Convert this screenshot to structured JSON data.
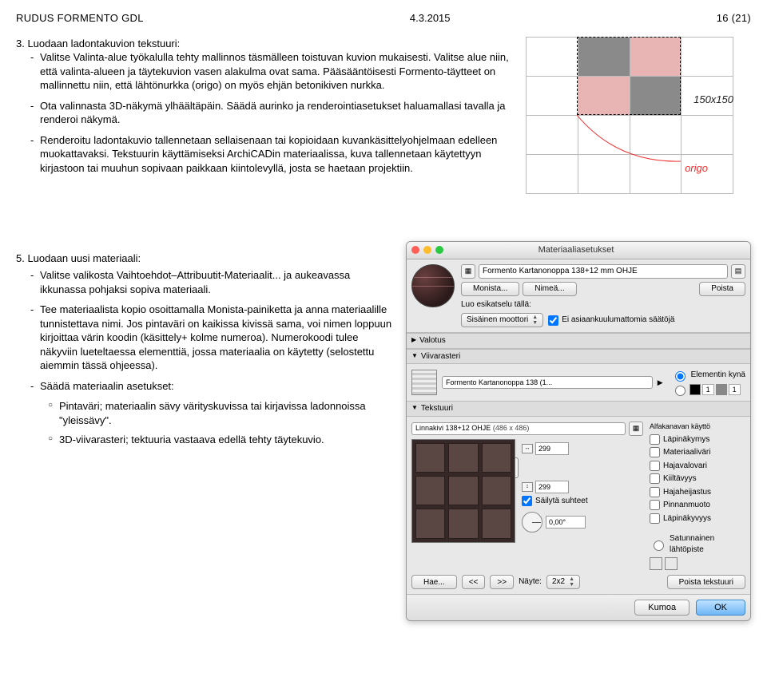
{
  "header": {
    "left": "RUDUS FORMENTO GDL",
    "date": "4.3.2015",
    "page": "16 (21)"
  },
  "sec3": {
    "title": "3. Luodaan ladontakuvion tekstuuri:",
    "b1": "Valitse Valinta-alue työkalulla tehty mallinnos täsmälleen toistuvan kuvion mukaisesti. Valitse alue niin, että valinta-alueen ja täytekuvion vasen alakulma ovat sama. Pääsääntöisesti Formento-täytteet on mallinnettu niin, että lähtönurkka (origo) on myös ehjän betonikiven nurkka.",
    "b2": "Ota valinnasta 3D-näkymä ylhäältäpäin. Säädä aurinko ja renderointiasetukset haluamallasi tavalla ja renderoi näkymä.",
    "b3": "Renderoitu ladontakuvio tallennetaan sellaisenaan tai kopioidaan kuvankäsittelyohjelmaan edelleen muokattavaksi. Tekstuurin käyttämiseksi ArchiCADin materiaalissa, kuva tallennetaan käytettyyn kirjastoon tai muuhun sopivaan paikkaan kiintolevyllä, josta se haetaan projektiin."
  },
  "fig1": {
    "size_label": "150x150",
    "origo": "origo"
  },
  "sec5": {
    "title": "5. Luodaan uusi materiaali:",
    "b1": "Valitse valikosta Vaihtoehdot–Attribuutit-Materiaalit... ja aukeavassa ikkunassa pohjaksi sopiva materiaali.",
    "b2": "Tee materiaalista kopio osoittamalla Monista-painiketta ja anna materiaalille tunnistettava nimi. Jos pintaväri on kaikissa kivissä sama, voi nimen loppuun kirjoittaa värin koodin (käsittely+ kolme numeroa). Numerokoodi tulee näkyviin lueteltaessa elementtiä, jossa materiaalia on käytetty (selostettu aiemmin tässä ohjeessa).",
    "b3": "Säädä materiaalin asetukset:",
    "s1": "Pintaväri; materiaalin sävy värityskuvissa tai kirjavissa ladonnoissa \"yleissävy\".",
    "s2": "3D-viivarasteri; tektuuria vastaava edellä tehty täytekuvio."
  },
  "dialog": {
    "title": "Materiaaliasetukset",
    "material_name": "Formento Kartanonoppa 138+12 mm OHJE",
    "btn_duplicate": "Monista...",
    "btn_rename": "Nimeä...",
    "btn_delete": "Poista",
    "preview_label": "Luo esikatselu tällä:",
    "engine": "Sisäinen moottori",
    "cb_unrelated": "Ei asiaankuulumattomia säätöjä",
    "sec_valotus": "Valotus",
    "sec_viivar": "Viivarasteri",
    "viivar_name": "Formento Kartanonoppa 138 (1...",
    "radio_pen": "Elementin kynä",
    "sec_tekstuuri": "Tekstuuri",
    "tex_name": "Linnakivi 138+12 OHJE",
    "tex_dims": "(486 x 486)",
    "dim_w": "299",
    "dim_h": "299",
    "cb_lock": "Säilytä suhteet",
    "angle": "0,00°",
    "alpha_title": "Alfakanavan käyttö",
    "alpha_items": [
      "Läpinäkymys",
      "Materiaaliväri",
      "Hajavalovari",
      "Kiiltävyys",
      "Hajaheijastus",
      "Pinnanmuoto",
      "Läpinäkyvyys"
    ],
    "rand_origin": "Satunnainen lähtöpiste",
    "btn_hae": "Hae...",
    "btn_prev": "<<",
    "btn_next": ">>",
    "sample_label": "Näyte:",
    "sample_val": "2x2",
    "btn_remove_tex": "Poista tekstuuri",
    "btn_cancel": "Kumoa",
    "btn_ok": "OK"
  }
}
